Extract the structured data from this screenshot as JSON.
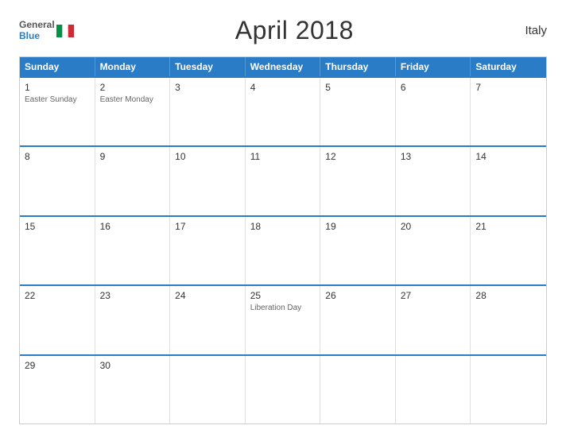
{
  "header": {
    "logo": {
      "general": "General",
      "blue": "Blue",
      "flag_colors": [
        "#009246",
        "#fff",
        "#ce2b37"
      ]
    },
    "title": "April 2018",
    "country": "Italy"
  },
  "calendar": {
    "days_of_week": [
      "Sunday",
      "Monday",
      "Tuesday",
      "Wednesday",
      "Thursday",
      "Friday",
      "Saturday"
    ],
    "weeks": [
      [
        {
          "day": "1",
          "event": "Easter Sunday"
        },
        {
          "day": "2",
          "event": "Easter Monday"
        },
        {
          "day": "3",
          "event": ""
        },
        {
          "day": "4",
          "event": ""
        },
        {
          "day": "5",
          "event": ""
        },
        {
          "day": "6",
          "event": ""
        },
        {
          "day": "7",
          "event": ""
        }
      ],
      [
        {
          "day": "8",
          "event": ""
        },
        {
          "day": "9",
          "event": ""
        },
        {
          "day": "10",
          "event": ""
        },
        {
          "day": "11",
          "event": ""
        },
        {
          "day": "12",
          "event": ""
        },
        {
          "day": "13",
          "event": ""
        },
        {
          "day": "14",
          "event": ""
        }
      ],
      [
        {
          "day": "15",
          "event": ""
        },
        {
          "day": "16",
          "event": ""
        },
        {
          "day": "17",
          "event": ""
        },
        {
          "day": "18",
          "event": ""
        },
        {
          "day": "19",
          "event": ""
        },
        {
          "day": "20",
          "event": ""
        },
        {
          "day": "21",
          "event": ""
        }
      ],
      [
        {
          "day": "22",
          "event": ""
        },
        {
          "day": "23",
          "event": ""
        },
        {
          "day": "24",
          "event": ""
        },
        {
          "day": "25",
          "event": "Liberation Day"
        },
        {
          "day": "26",
          "event": ""
        },
        {
          "day": "27",
          "event": ""
        },
        {
          "day": "28",
          "event": ""
        }
      ],
      [
        {
          "day": "29",
          "event": ""
        },
        {
          "day": "30",
          "event": ""
        },
        {
          "day": "",
          "event": ""
        },
        {
          "day": "",
          "event": ""
        },
        {
          "day": "",
          "event": ""
        },
        {
          "day": "",
          "event": ""
        },
        {
          "day": "",
          "event": ""
        }
      ]
    ]
  }
}
